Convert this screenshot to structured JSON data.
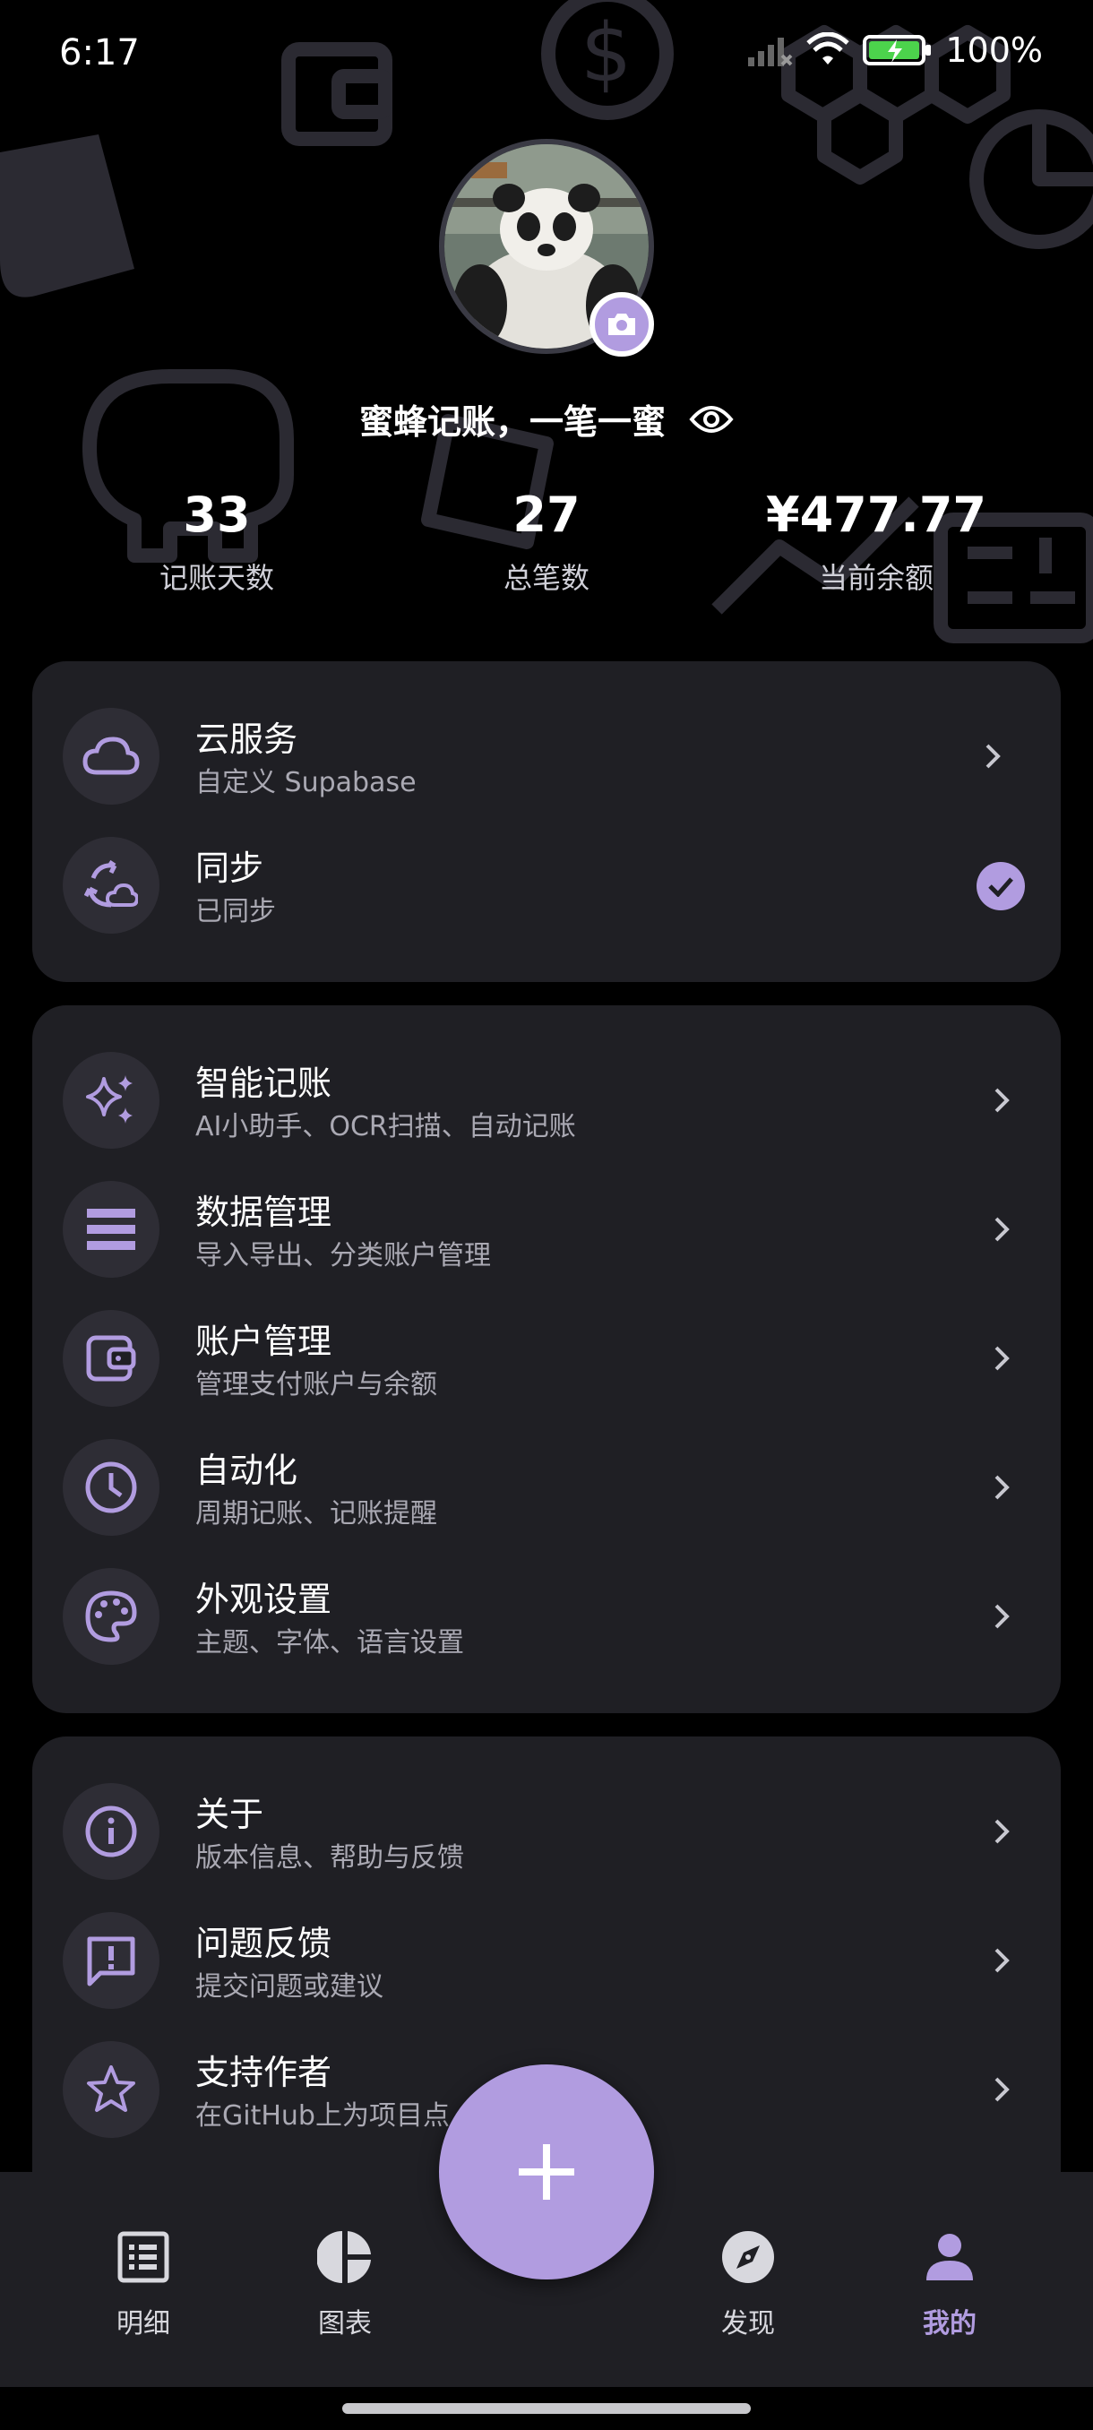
{
  "status_bar": {
    "time": "6:17",
    "battery": "100%"
  },
  "profile": {
    "name": "蜜蜂记账，一笔一蜜",
    "stats": [
      {
        "value": "33",
        "label": "记账天数"
      },
      {
        "value": "27",
        "label": "总笔数"
      },
      {
        "value": "¥477.77",
        "label": "当前余额"
      }
    ]
  },
  "cloud_card": {
    "items": [
      {
        "title": "云服务",
        "subtitle": "自定义 Supabase",
        "icon": "cloud-icon"
      },
      {
        "title": "同步",
        "subtitle": "已同步",
        "icon": "sync-icon"
      }
    ]
  },
  "features_card": {
    "items": [
      {
        "title": "智能记账",
        "subtitle": "AI小助手、OCR扫描、自动记账",
        "icon": "sparkle-icon"
      },
      {
        "title": "数据管理",
        "subtitle": "导入导出、分类账户管理",
        "icon": "list-icon"
      },
      {
        "title": "账户管理",
        "subtitle": "管理支付账户与余额",
        "icon": "wallet-icon"
      },
      {
        "title": "自动化",
        "subtitle": "周期记账、记账提醒",
        "icon": "clock-icon"
      },
      {
        "title": "外观设置",
        "subtitle": "主题、字体、语言设置",
        "icon": "palette-icon"
      }
    ]
  },
  "about_card": {
    "items": [
      {
        "title": "关于",
        "subtitle": "版本信息、帮助与反馈",
        "icon": "info-icon"
      },
      {
        "title": "问题反馈",
        "subtitle": "提交问题或建议",
        "icon": "feedback-icon"
      },
      {
        "title": "支持作者",
        "subtitle": "在GitHub上为项目点",
        "icon": "star-icon"
      }
    ]
  },
  "bottom_nav": {
    "items": [
      {
        "label": "明细",
        "icon": "list-doc-icon"
      },
      {
        "label": "图表",
        "icon": "pie-chart-icon"
      },
      {
        "label": "发现",
        "icon": "compass-icon"
      },
      {
        "label": "我的",
        "icon": "person-icon"
      }
    ],
    "active": "我的"
  },
  "colors": {
    "accent": "#b19ce0",
    "card": "#1f1f24",
    "background": "#000000",
    "icon_bg": "#2e2d35"
  }
}
